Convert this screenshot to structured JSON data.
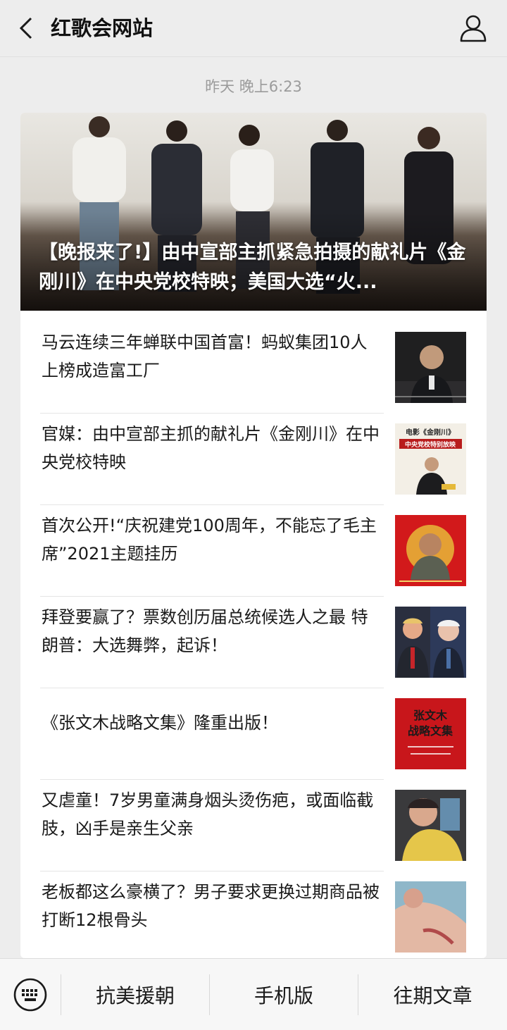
{
  "header": {
    "title": "红歌会网站",
    "back_icon": "chevron-left-icon",
    "profile_icon": "user-profile-icon"
  },
  "timestamp": "昨天 晚上6:23",
  "hero": {
    "title": "【晚报来了!】由中宣部主抓紧急拍摄的献礼片《金刚川》在中央党校特映；美国大选“火..."
  },
  "articles": [
    {
      "title": "马云连续三年蝉联中国首富！蚂蚁集团10人上榜成造富工厂",
      "thumb": "man-speaking-thumbnail"
    },
    {
      "title": "官媒：由中宣部主抓的献礼片《金刚川》在中央党校特映",
      "thumb": "movie-screening-poster-thumbnail",
      "thumb_text": [
        "电影《金刚川》",
        "中央党校特别放映"
      ]
    },
    {
      "title": "首次公开!“庆祝建党100周年，不能忘了毛主席”2021主题挂历",
      "thumb": "calendar-portrait-thumbnail"
    },
    {
      "title": "拜登要赢了？票数创历届总统候选人之最 特朗普：大选舞弊，起诉！",
      "thumb": "two-candidates-thumbnail"
    },
    {
      "title": "《张文木战略文集》隆重出版！",
      "thumb": "book-cover-thumbnail",
      "thumb_text": [
        "张文木",
        "战略文集"
      ]
    },
    {
      "title": "又虐童！7岁男童满身烟头烫伤疤，或面临截肢，凶手是亲生父亲",
      "thumb": "injured-child-thumbnail"
    },
    {
      "title": "老板都这么豪横了？男子要求更换过期商品被打断12根骨头",
      "thumb": "hospital-patient-thumbnail"
    }
  ],
  "bottom_menu": {
    "keyboard_icon": "keyboard-icon",
    "items": [
      "抗美援朝",
      "手机版",
      "往期文章"
    ]
  },
  "colors": {
    "background": "#ededed",
    "card": "#ffffff",
    "secondary_text": "#9b9b9b"
  }
}
